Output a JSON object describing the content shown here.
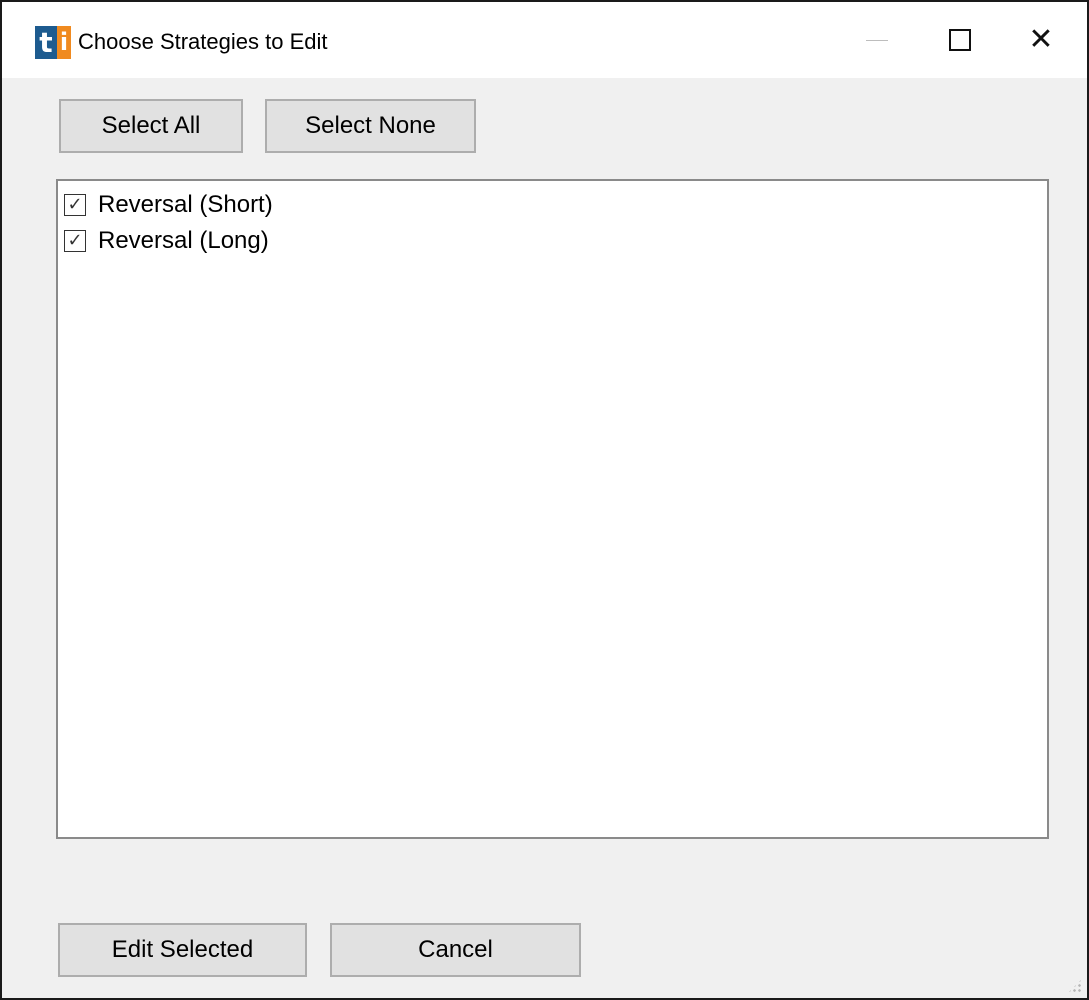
{
  "window": {
    "title": "Choose Strategies to Edit",
    "icon": "ti-app-icon",
    "icon_letters": {
      "t": "t",
      "i": "i"
    },
    "controls": {
      "minimize": "—",
      "maximize": "",
      "close": "✕"
    }
  },
  "toolbar": {
    "select_all_label": "Select All",
    "select_none_label": "Select None"
  },
  "strategies": {
    "items": [
      {
        "label": "Reversal (Short)",
        "checked": true
      },
      {
        "label": "Reversal (Long)",
        "checked": true
      }
    ]
  },
  "footer": {
    "edit_selected_label": "Edit Selected",
    "cancel_label": "Cancel"
  },
  "colors": {
    "window_bg": "#f0f0f0",
    "button_bg": "#e1e1e1",
    "button_border": "#adadad",
    "icon_blue": "#1d5b8f",
    "icon_orange": "#f08a1f"
  }
}
